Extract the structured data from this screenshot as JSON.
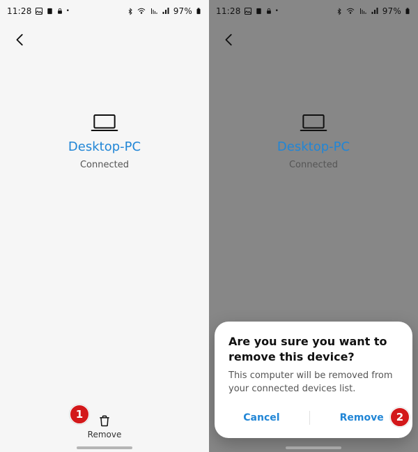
{
  "statusbar": {
    "time": "11:28",
    "battery": "97%"
  },
  "device": {
    "name": "Desktop-PC",
    "status": "Connected"
  },
  "action": {
    "remove_label": "Remove"
  },
  "dialog": {
    "title": "Are you sure you want to remove this device?",
    "body": "This computer will be removed from your connected devices list.",
    "cancel": "Cancel",
    "confirm": "Remove"
  },
  "badges": {
    "one": "1",
    "two": "2"
  }
}
